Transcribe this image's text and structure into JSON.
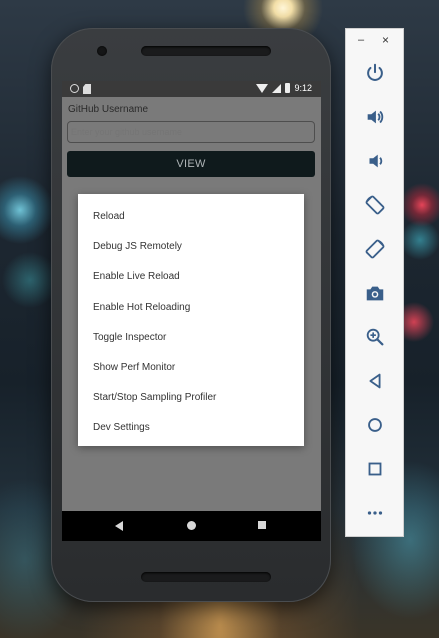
{
  "device": {
    "status_bar": {
      "time": "9:12"
    }
  },
  "app": {
    "label": "GitHub Username",
    "input_placeholder": "Enter your github username",
    "button_label": "VIEW"
  },
  "dev_menu": {
    "items": [
      {
        "label": "Reload"
      },
      {
        "label": "Debug JS Remotely"
      },
      {
        "label": "Enable Live Reload"
      },
      {
        "label": "Enable Hot Reloading"
      },
      {
        "label": "Toggle Inspector"
      },
      {
        "label": "Show Perf Monitor"
      },
      {
        "label": "Start/Stop Sampling Profiler"
      },
      {
        "label": "Dev Settings"
      }
    ]
  },
  "emulator_toolbar": {
    "minimize_glyph": "–",
    "close_glyph": "×",
    "tools": [
      "power-icon",
      "volume-up-icon",
      "volume-down-icon",
      "rotate-left-icon",
      "rotate-right-icon",
      "camera-icon",
      "zoom-icon",
      "back-icon",
      "home-icon",
      "overview-icon",
      "more-icon"
    ],
    "icon_color": "#3a5f8a"
  },
  "colors": {
    "view_button_bg": "#0f1a1c",
    "menu_bg": "#ffffff",
    "scrim": "#7a7a7a"
  }
}
